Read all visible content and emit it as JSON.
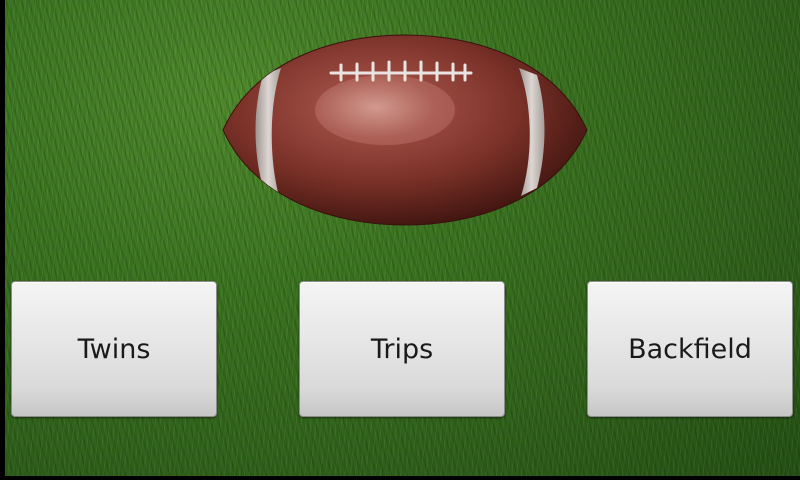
{
  "buttons": {
    "twins": "Twins",
    "trips": "Trips",
    "backfield": "Backfield"
  },
  "colors": {
    "grass": "#3b7420",
    "football": "#7a3128",
    "stripe": "#d8d0cc",
    "button_text": "#1a1a1a"
  },
  "icons": {
    "football": "football-icon"
  }
}
